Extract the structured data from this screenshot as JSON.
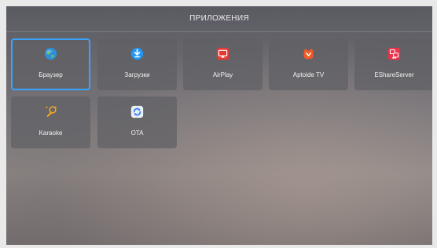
{
  "header": {
    "title": "ПРИЛОЖЕНИЯ"
  },
  "apps": [
    {
      "label": "Браузер",
      "icon": "globe-icon",
      "color": "#2f8fd6"
    },
    {
      "label": "Загрузки",
      "icon": "download-icon",
      "color": "#2196f3"
    },
    {
      "label": "AirPlay",
      "icon": "airplay-icon",
      "color": "#e53935"
    },
    {
      "label": "Aptoide TV",
      "icon": "aptoide-icon",
      "color": "#f05a28"
    },
    {
      "label": "EShareServer",
      "icon": "eshare-icon",
      "color": "#e8334a"
    },
    {
      "label": "Karaoke",
      "icon": "microphone-icon",
      "color": "#f5a623"
    },
    {
      "label": "OTA",
      "icon": "ota-refresh-icon",
      "color": "#2f80ed"
    }
  ],
  "selected_app": "Браузер",
  "accent_color": "#3aa2ff"
}
